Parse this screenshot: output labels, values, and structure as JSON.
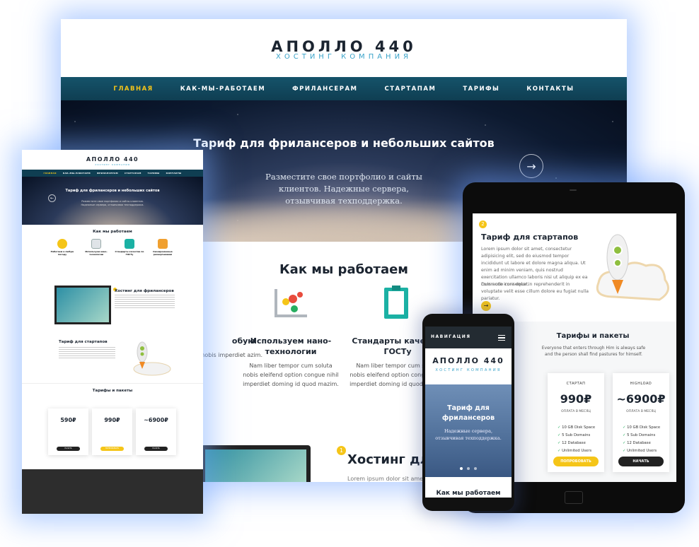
{
  "desktop": {
    "brand": "АПОЛЛО 440",
    "tagline": "ХОСТИНГ КОМПАНИЯ",
    "nav": [
      "ГЛАВНАЯ",
      "КАК-МЫ-РАБОТАЕМ",
      "ФРИЛАНСЕРАМ",
      "СТАРТАПАМ",
      "ТАРИФЫ",
      "КОНТАКТЫ"
    ],
    "hero_title": "Тариф для фрилансеров и небольших сайтов",
    "hero_text": "Разместите свое портфолио и сайты клиентов. Надежные сервера, отзывчивая техподдержка.",
    "section_title": "Как мы работаем",
    "features": [
      {
        "title": "обую",
        "text": "олута nobis imperdiet azim."
      },
      {
        "title": "Используем нано-технологии",
        "text": "Nam liber tempor cum soluta nobis eleifend option congue nihil imperdiet doming id quod mazim."
      },
      {
        "title": "Стандарты качес по ГОСТу",
        "text": "Nam liber tempor cum soluta nobis eleifend option congue nihil imperdiet doming id quod mazim."
      }
    ],
    "step_number": "1",
    "hosting_title": "Хостинг дл",
    "lorem": "Lorem ipsum dolor sit amet,"
  },
  "small": {
    "brand": "АПОЛЛО 440",
    "tagline": "ХОСТИНГ КОМПАНИЯ",
    "nav": [
      "ГЛАВНАЯ",
      "КАК-МЫ-РАБОТАЕМ",
      "ФРИЛАНСЕРАМ",
      "СТАРТАПАМ",
      "ТАРИФЫ",
      "КОНТАКТЫ"
    ],
    "hero_title": "Тариф для фрилансеров и небольших сайтов",
    "hero_text": "Разместите свое портфолио и сайты клиентов. Надежные сервера, отзывчивая техподдержка.",
    "how_title": "Как мы работаем",
    "features": [
      {
        "title": "Работаем в любую погоду"
      },
      {
        "title": "Используем нано-технологии"
      },
      {
        "title": "Стандарты качества по ГОСТу"
      },
      {
        "title": "Своевременные развертывания"
      }
    ],
    "freelance_title": "Хостинг для фрилансеров",
    "startup_title": "Тариф для стартапов",
    "plans_title": "Тарифы и пакеты",
    "prices": [
      {
        "value": "590₽",
        "btn": "НАЧАТЬ"
      },
      {
        "value": "990₽",
        "btn": "ПОПРОБОВАТЬ"
      },
      {
        "value": "~6900₽",
        "btn": "НАЧАТЬ"
      }
    ]
  },
  "tablet": {
    "step_number": "2",
    "startup_title": "Тариф для стартапов",
    "startup_text": "Lorem ipsum dolor sit amet, consectetur adipisicing elit, sed do eiusmod tempor incididunt ut labore et dolore magna aliqua. Ut enim ad minim veniam, quis nostrud exercitation ullamco laboris nisi ut aliquip ex ea commodo consequat.",
    "startup_text2": "Duis aute irure dolor in reprehenderit in voluptate velit esse cillum dolore eu fugiat nulla pariatur.",
    "plans_title": "Тарифы и пакеты",
    "plans_text": "Everyone that enters through Him is always safe and the person shall find pastures for himself.",
    "plans": [
      {
        "name": "СТАРТАП",
        "price": "990₽",
        "period": "ОПЛАТА В МЕСЯЦ",
        "features": [
          "10 GB Disk Space",
          "5 Sub Domains",
          "12 Database",
          "Unlimited Users"
        ],
        "button": "ПОПРОБОВАТЬ"
      },
      {
        "name": "HIGHLOAD",
        "price": "~6900₽",
        "period": "ОПЛАТА В МЕСЯЦ",
        "features": [
          "10 GB Disk Space",
          "5 Sub Domains",
          "12 Database",
          "Unlimited Users"
        ],
        "button": "НАЧАТЬ"
      }
    ]
  },
  "phone": {
    "nav_label": "НАВИГАЦИЯ",
    "brand": "АПОЛЛО 440",
    "tagline": "ХОСТИНГ КОМПАНИЯ",
    "hero_title": "Тариф для фрилансеров",
    "hero_text": "Надежные сервера, отзывчивая техподдержка.",
    "section_title": "Как мы работаем"
  },
  "colors": {
    "accent": "#f5c518",
    "nav": "#0f3e52",
    "tagline": "#3aa3c9"
  }
}
